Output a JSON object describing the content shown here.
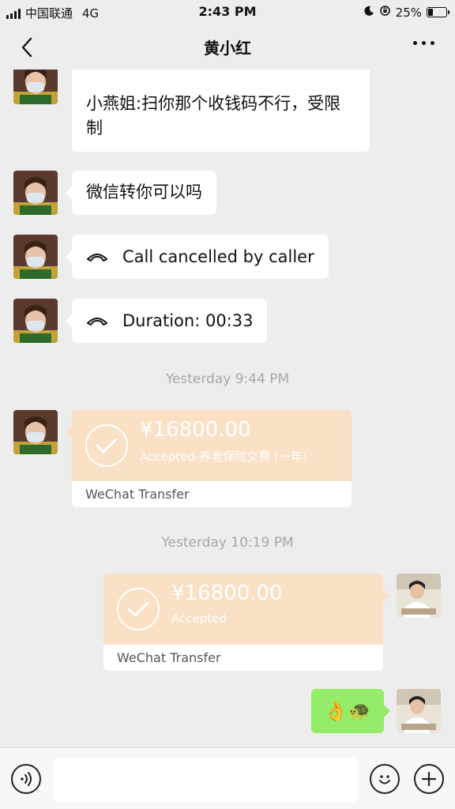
{
  "status_bar": {
    "carrier": "中国联通",
    "network": "4G",
    "time": "2:43 PM",
    "battery_percent": "25%",
    "battery_level": 0.25
  },
  "nav": {
    "title": "黄小红",
    "back_icon": "chevron-left-icon",
    "more_icon": "more-dots-icon"
  },
  "messages": {
    "msg1": "小燕姐:扫你那个收钱码不行，受限制",
    "msg2": "微信转你可以吗",
    "call1": "Call cancelled by caller",
    "call2": "Duration: 00:33",
    "time1": "Yesterday 9:44 PM",
    "transfer1": {
      "amount": "¥16800.00",
      "status": "Accepted-养老保险交费 (一年)",
      "footer": "WeChat Transfer"
    },
    "time2": "Yesterday 10:19 PM",
    "transfer2": {
      "amount": "¥16800.00",
      "status": "Accepted",
      "footer": "WeChat Transfer"
    },
    "emoji_message": "👌🐢"
  },
  "input_bar": {
    "voice_icon": "voice-icon",
    "emoji_icon": "emoji-icon",
    "add_icon": "plus-icon",
    "placeholder": ""
  },
  "colors": {
    "background": "#ededed",
    "bubble_white": "#ffffff",
    "bubble_green": "#95ec69",
    "transfer_orange": "#fae0c4"
  }
}
